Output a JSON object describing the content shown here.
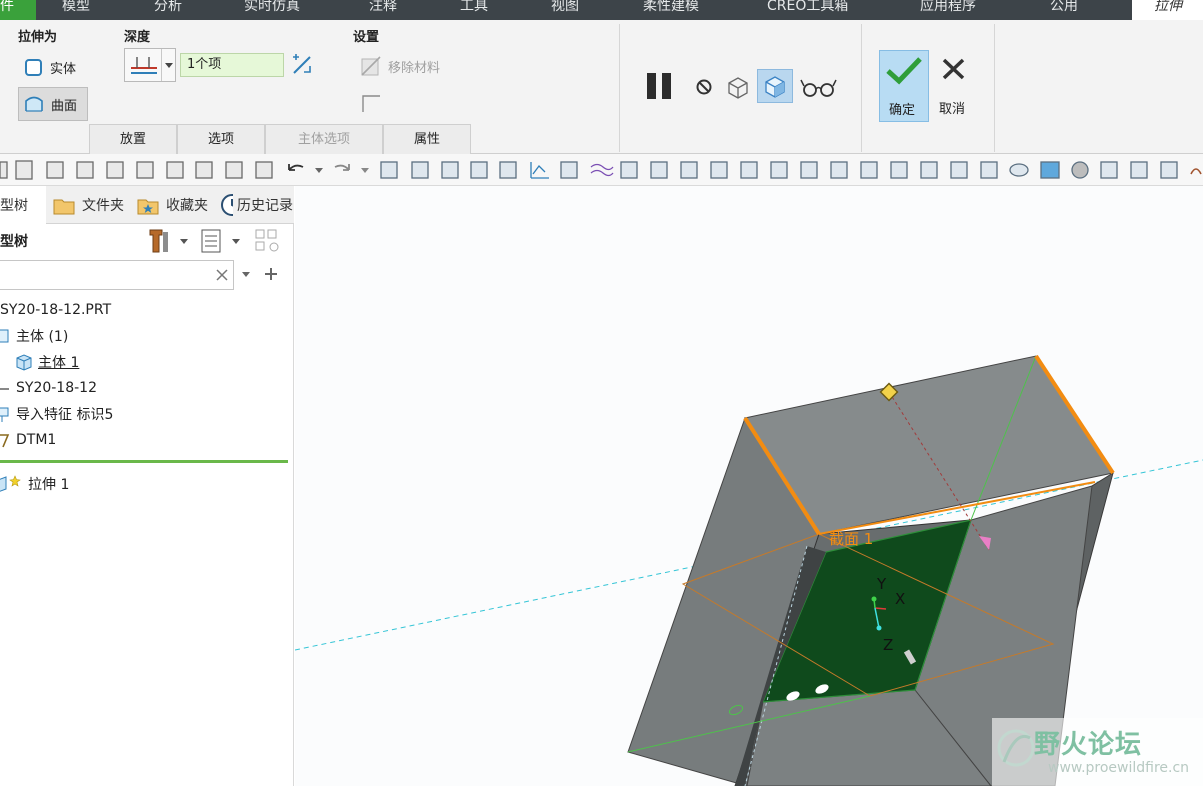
{
  "tabs": [
    {
      "label": "文件",
      "state": "green"
    },
    {
      "label": "模型"
    },
    {
      "label": "分析"
    },
    {
      "label": "实时仿真"
    },
    {
      "label": "注释"
    },
    {
      "label": "工具"
    },
    {
      "label": "视图"
    },
    {
      "label": "柔性建模"
    },
    {
      "label": "CREO工具箱"
    },
    {
      "label": "应用程序"
    },
    {
      "label": "公用"
    },
    {
      "label": "拉伸",
      "state": "active"
    }
  ],
  "ribbon": {
    "extrude_as": {
      "title": "拉伸为",
      "solid_label": "实体",
      "surface_label": "曲面"
    },
    "depth": {
      "title": "深度",
      "value": "1个项"
    },
    "settings": {
      "title": "设置",
      "remove_material_label": "移除材料"
    },
    "subtabs": [
      "放置",
      "选项",
      "主体选项",
      "属性"
    ],
    "ok_label": "确定",
    "cancel_label": "取消"
  },
  "panel": {
    "tabs": [
      "模型树",
      "文件夹",
      "收藏夹",
      "历史记录"
    ],
    "tree_title": "模型树",
    "tree": [
      {
        "label": "SY20-18-12.PRT",
        "icon": "part-icon"
      },
      {
        "label": "主体 (1)",
        "icon": "body-group-icon"
      },
      {
        "label": "主体 1",
        "icon": "body-icon",
        "underline": true
      },
      {
        "label": "SY20-18-12",
        "icon": "csys-icon"
      },
      {
        "label": "导入特征 标识5",
        "icon": "import-feature-icon"
      },
      {
        "label": "DTM1",
        "icon": "datum-plane-icon"
      }
    ],
    "insert_row": {
      "label": "拉伸 1",
      "icon": "extrude-feature-icon"
    }
  },
  "viewport": {
    "section_label": "截面 1",
    "axis_x": "X",
    "axis_y": "Y",
    "axis_z": "Z"
  },
  "watermark": {
    "title": "野火论坛",
    "url": "www.proewildfire.cn"
  },
  "colors": {
    "tabbar": "#3d4449",
    "file_tab": "#3aa13b",
    "ok_button": "#b8dcf3",
    "section_face": "#0f4a1c",
    "highlight_edge": "#f28c12",
    "model_gray": "#7d8283"
  }
}
